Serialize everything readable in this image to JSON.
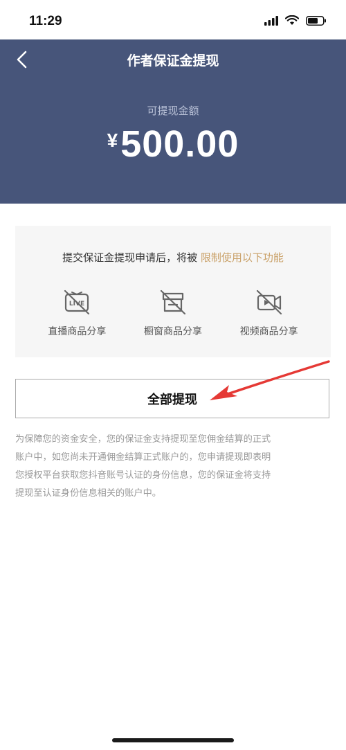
{
  "status": {
    "time": "11:29"
  },
  "header": {
    "title": "作者保证金提现",
    "amount_label": "可提现金额",
    "currency": "¥",
    "amount": "500.00"
  },
  "notice": {
    "text": "提交保证金提现申请后，将被",
    "highlight": "限制使用以下功能",
    "highlight_color": "#c9a067",
    "features": [
      {
        "icon": "live-disabled-icon",
        "label": "直播商品分享"
      },
      {
        "icon": "showcase-disabled-icon",
        "label": "橱窗商品分享"
      },
      {
        "icon": "video-disabled-icon",
        "label": "视频商品分享"
      }
    ]
  },
  "withdraw_button": "全部提现",
  "description_lines": [
    "为保障您的资金安全，您的保证金支持提现至您佣金结算的正式",
    "账户中，如您尚未开通佣金结算正式账户的，您申请提现即表明",
    "您授权平台获取您抖音账号认证的身份信息，您的保证金将支持",
    "提现至认证身份信息相关的账户中。"
  ],
  "colors": {
    "header_bg": "#47557a",
    "annotation_arrow": "#e53935"
  }
}
